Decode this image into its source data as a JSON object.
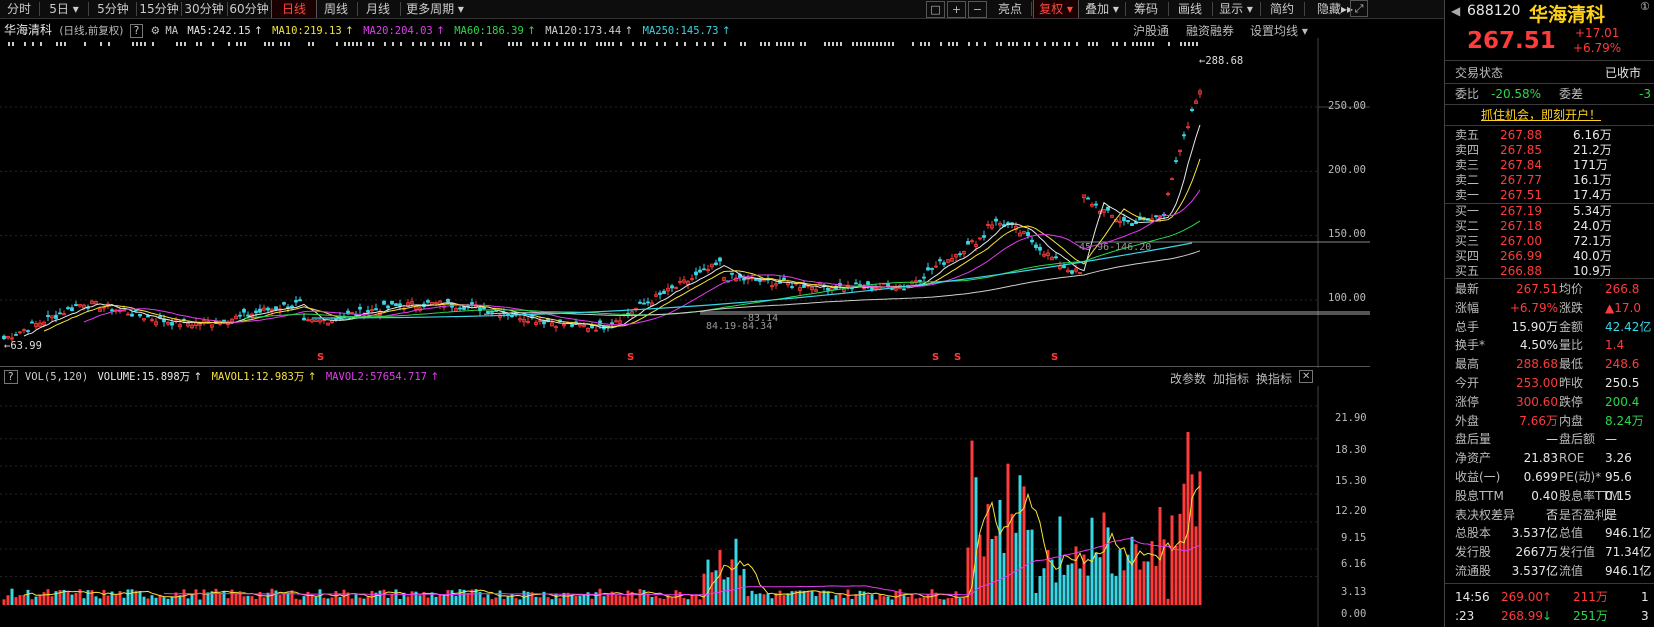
{
  "toolbar": {
    "periods": [
      "分时",
      "5日",
      "5分钟",
      "15分钟",
      "30分钟",
      "60分钟",
      "日线",
      "周线",
      "月线",
      "更多周期"
    ],
    "active_period": "日线",
    "right_items": [
      "亮点",
      "复权",
      "叠加",
      "筹码",
      "画线",
      "显示",
      "简约",
      "隐藏"
    ],
    "hide_arrow": "▸▸",
    "icons": [
      "□",
      "+",
      "−"
    ]
  },
  "ma_line": {
    "name": "华海清科",
    "mode": "(日线,前复权)",
    "q": "?",
    "ma": "MA",
    "ma5": "MA5:242.15",
    "ma10": "MA10:219.13",
    "ma20": "MA20:204.03",
    "ma60": "MA60:186.39",
    "ma120": "MA120:173.44",
    "ma250": "MA250:145.73",
    "arrow": "↑",
    "links": [
      "沪股通",
      "融资融券",
      "设置均线"
    ]
  },
  "price_axis": [
    "250.00",
    "200.00",
    "150.00",
    "100.00"
  ],
  "price_notes": {
    "high": "←288.68",
    "low": "←63.99",
    "mark1": "45.96-146.20",
    "mark2": "84.19-84.34",
    "mark3": "-83.14"
  },
  "event_marker": "S",
  "vol_line": {
    "q": "?",
    "label": "VOL(5,120)",
    "volume": "VOLUME:15.898万",
    "mavol1": "MAVOL1:12.983万",
    "mavol2": "MAVOL2:57654.717",
    "arrow": "↑",
    "links": [
      "改参数",
      "加指标",
      "换指标"
    ],
    "close": "✕"
  },
  "vol_axis": [
    "21.90",
    "18.30",
    "15.30",
    "12.20",
    "9.15",
    "6.16",
    "3.13",
    "0.00"
  ],
  "quote": {
    "code": "688120",
    "name": "华海清科",
    "price": "267.51",
    "change": "+17.01",
    "change_pct": "+6.79%",
    "status_label": "交易状态",
    "status_value": "已收市",
    "webi_label": "委比",
    "webi_value": "-20.58%",
    "weicha_label": "委差",
    "weicha_value": "-3",
    "promo": "抓住机会，即刻开户！",
    "asks": [
      {
        "label": "卖五",
        "price": "267.88",
        "vol": "6.16万"
      },
      {
        "label": "卖四",
        "price": "267.85",
        "vol": "21.2万"
      },
      {
        "label": "卖三",
        "price": "267.84",
        "vol": "171万"
      },
      {
        "label": "卖二",
        "price": "267.77",
        "vol": "16.1万"
      },
      {
        "label": "卖一",
        "price": "267.51",
        "vol": "17.4万"
      }
    ],
    "bids": [
      {
        "label": "买一",
        "price": "267.19",
        "vol": "5.34万"
      },
      {
        "label": "买二",
        "price": "267.18",
        "vol": "24.0万"
      },
      {
        "label": "买三",
        "price": "267.00",
        "vol": "72.1万"
      },
      {
        "label": "买四",
        "price": "266.99",
        "vol": "40.0万"
      },
      {
        "label": "买五",
        "price": "266.88",
        "vol": "10.9万"
      }
    ],
    "stats": [
      {
        "l1": "最新",
        "v1": "267.51",
        "c1": "red",
        "l2": "均价",
        "v2": "266.8",
        "c2": "red"
      },
      {
        "l1": "涨幅",
        "v1": "+6.79%",
        "c1": "red",
        "l2": "涨跌",
        "v2": "▲17.0",
        "c2": "red"
      },
      {
        "l1": "总手",
        "v1": "15.90万",
        "c1": "white",
        "l2": "金额",
        "v2": "42.42亿",
        "c2": "cyan"
      },
      {
        "l1": "换手*",
        "v1": "4.50%",
        "c1": "white",
        "l2": "量比",
        "v2": "1.4",
        "c2": "red"
      },
      {
        "l1": "最高",
        "v1": "288.68",
        "c1": "red",
        "l2": "最低",
        "v2": "248.6",
        "c2": "red"
      },
      {
        "l1": "今开",
        "v1": "253.00",
        "c1": "red",
        "l2": "昨收",
        "v2": "250.5",
        "c2": "white"
      },
      {
        "l1": "涨停",
        "v1": "300.60",
        "c1": "red",
        "l2": "跌停",
        "v2": "200.4",
        "c2": "green"
      },
      {
        "l1": "外盘",
        "v1": "7.66万",
        "c1": "red",
        "l2": "内盘",
        "v2": "8.24万",
        "c2": "green"
      },
      {
        "l1": "盘后量",
        "v1": "—",
        "c1": "white",
        "l2": "盘后额",
        "v2": "—",
        "c2": "white"
      },
      {
        "l1": "净资产",
        "v1": "21.83",
        "c1": "white",
        "l2": "ROE",
        "v2": "3.26",
        "c2": "white"
      },
      {
        "l1": "收益(一)",
        "v1": "0.699",
        "c1": "white",
        "l2": "PE(动)*",
        "v2": "95.6",
        "c2": "white"
      },
      {
        "l1": "股息TTM",
        "v1": "0.40",
        "c1": "white",
        "l2": "股息率TTM",
        "v2": "0.15",
        "c2": "white"
      },
      {
        "l1": "表决权差异",
        "v1": "否",
        "c1": "white",
        "l2": "是否盈利",
        "v2": "是",
        "c2": "white"
      },
      {
        "l1": "总股本",
        "v1": "3.537亿",
        "c1": "white",
        "l2": "总值",
        "v2": "946.1亿",
        "c2": "white"
      },
      {
        "l1": "发行股",
        "v1": "2667万",
        "c1": "white",
        "l2": "发行值",
        "v2": "71.34亿",
        "c2": "white"
      },
      {
        "l1": "流通股",
        "v1": "3.537亿",
        "c1": "white",
        "l2": "流值",
        "v2": "946.1亿",
        "c2": "white"
      }
    ],
    "ticks": [
      {
        "time": "14:56",
        "price": "269.00",
        "arrow": "↑",
        "vol": "211万",
        "extra": "1"
      },
      {
        "time": ":23",
        "price": "268.99",
        "arrow": "↓",
        "vol": "251万",
        "extra": "3"
      }
    ]
  }
}
